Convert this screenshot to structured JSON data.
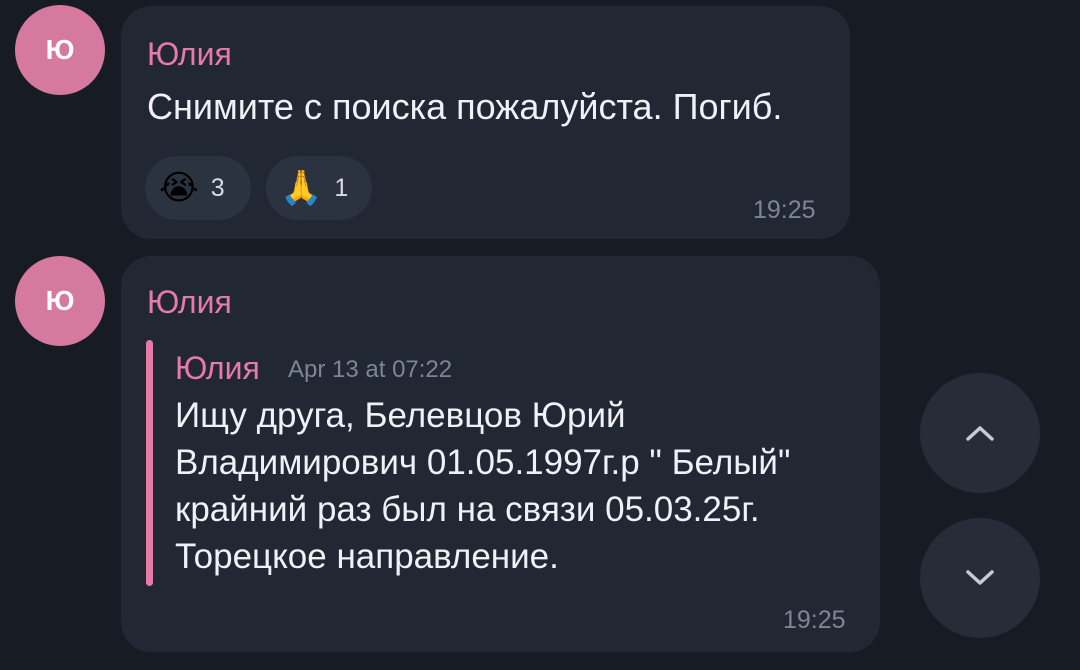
{
  "messages": [
    {
      "avatar_letter": "Ю",
      "sender": "Юлия",
      "text": "Снимите с поиска пожалуйста. Погиб.",
      "reactions": [
        {
          "emoji": "😭",
          "icon": "loudly-crying-face-icon",
          "count": "3"
        },
        {
          "emoji": "🙏",
          "icon": "folded-hands-icon",
          "count": "1"
        }
      ],
      "time": "19:25"
    },
    {
      "avatar_letter": "Ю",
      "sender": "Юлия",
      "forwarded": {
        "sender": "Юлия",
        "date": "Apr 13 at 07:22",
        "text_lines": [
          "Ищу друга, Белевцов Юрий",
          "Владимирович 01.05.1997г.р \" Белый\"",
          "крайний раз был на связи 05.03.25г.",
          "Торецкое направление."
        ]
      },
      "time": "19:25"
    }
  ],
  "scroll_buttons": {
    "up_icon": "chevron-up-icon",
    "down_icon": "chevron-down-icon"
  },
  "colors": {
    "background": "#171c24",
    "bubble": "#212733",
    "accent_pink": "#e67ba8",
    "avatar": "#d5799f"
  }
}
